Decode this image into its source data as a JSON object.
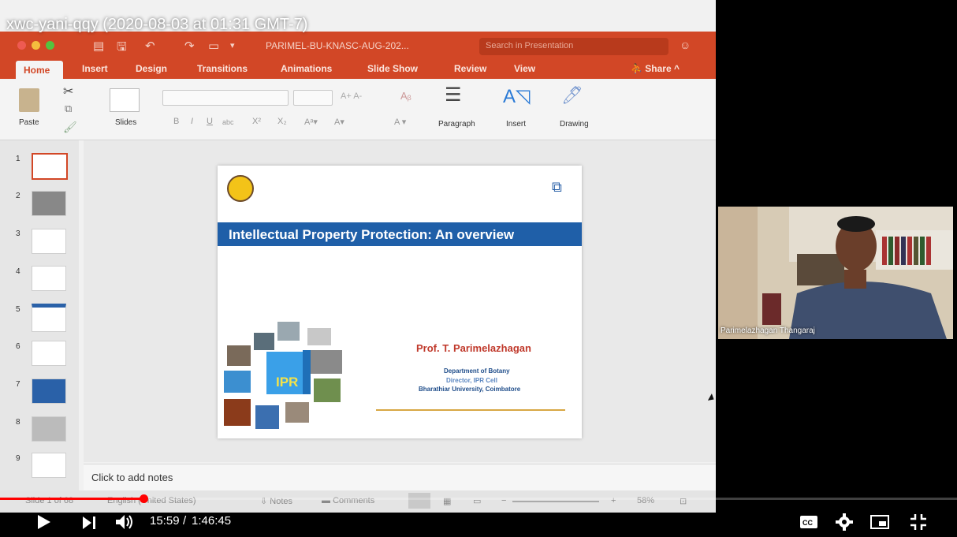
{
  "video": {
    "title": "xwc-yani-qqy (2020-08-03 at 01:31 GMT-7)",
    "current_time": "15:59",
    "duration": "1:46:45",
    "progress": 0.15
  },
  "ppt": {
    "doc_name": "PARIMEL-BU-KNASC-AUG-202...",
    "search_placeholder": "Search in Presentation",
    "tabs": [
      "Home",
      "Insert",
      "Design",
      "Transitions",
      "Animations",
      "Slide Show",
      "Review",
      "View"
    ],
    "share_label": "Share",
    "ribbon": {
      "paste": "Paste",
      "slides": "Slides",
      "paragraph": "Paragraph",
      "insert": "Insert",
      "drawing": "Drawing"
    },
    "thumbnails": [
      "1",
      "2",
      "3",
      "4",
      "5",
      "6",
      "7",
      "8",
      "9"
    ],
    "notes_placeholder": "Click to add notes",
    "status": {
      "slide_of": "Slide 1 of 68",
      "language": "English (United States)",
      "notes": "Notes",
      "comments": "Comments",
      "zoom": "58%"
    }
  },
  "slide": {
    "title": "Intellectual Property Protection: An overview",
    "presenter": "Prof. T. Parimelazhagan",
    "dept": "Department of Botany",
    "role": "Director, IPR Cell",
    "university": "Bharathiar University, Coimbatore",
    "collage_label": "IPR"
  },
  "webcam": {
    "name": "Parimelazhagan Thangaraj"
  },
  "colors": {
    "ppt_accent": "#d24726",
    "slide_banner": "#1f5fa8",
    "progress": "#ff0000"
  }
}
